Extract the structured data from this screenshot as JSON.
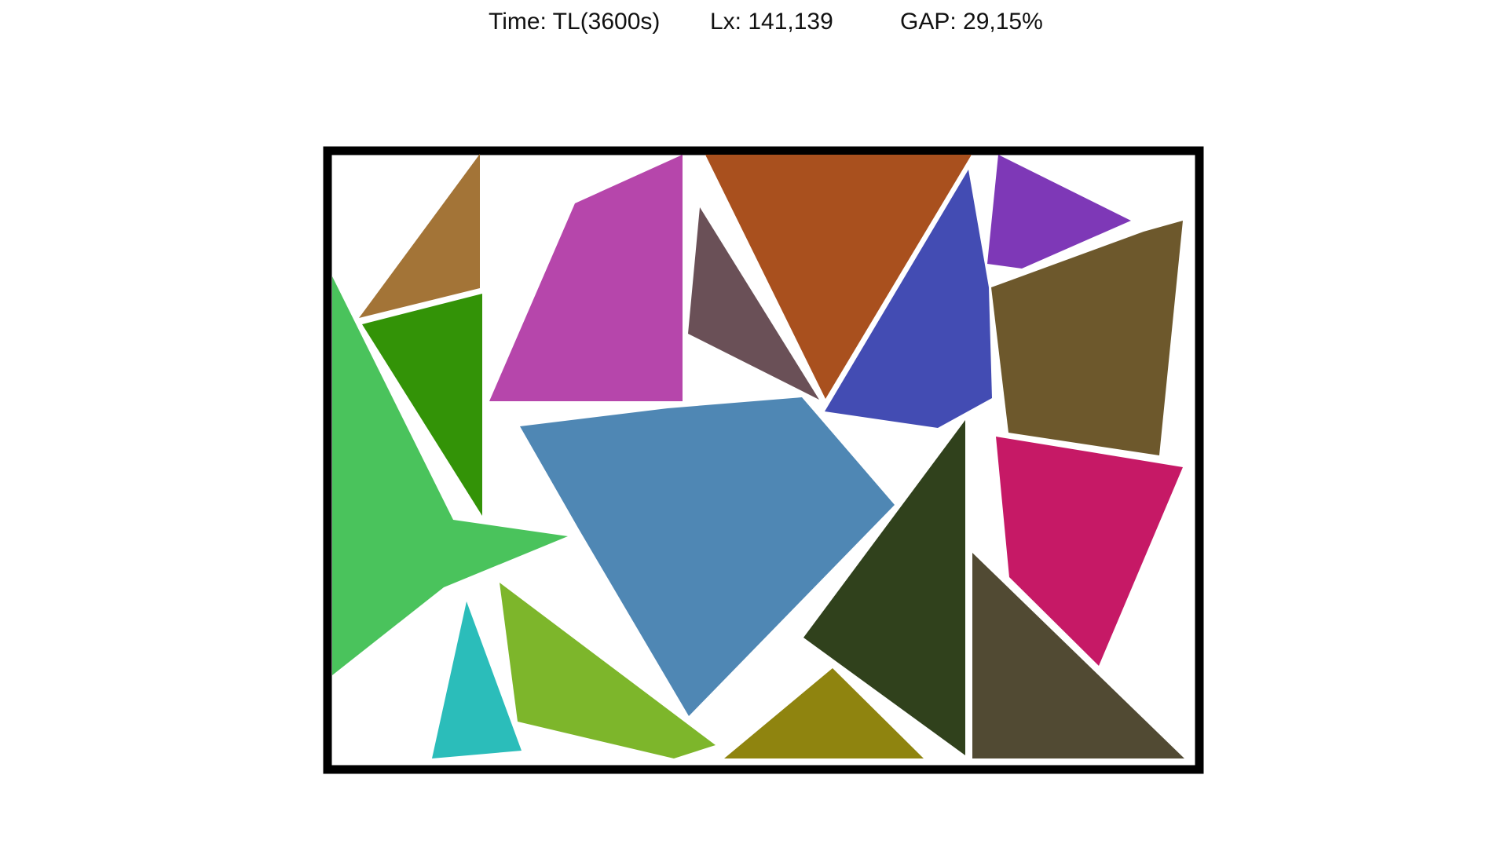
{
  "stats": {
    "time": "Time: TL(3600s)",
    "lx": "Lx: 141,139",
    "gap": "GAP: 29,15%"
  },
  "board": {
    "frame_color": "#000000",
    "pieces": [
      {
        "name": "piece-tan-triangle",
        "color": "#A37437"
      },
      {
        "name": "piece-dark-green-triangle",
        "color": "#339307"
      },
      {
        "name": "piece-light-green-star",
        "color": "#4AC35C"
      },
      {
        "name": "piece-magenta-quad",
        "color": "#B646AB"
      },
      {
        "name": "piece-orange-brown-triangle",
        "color": "#A9501E"
      },
      {
        "name": "piece-dusky-triangle",
        "color": "#6A5057"
      },
      {
        "name": "piece-indigo-polygon",
        "color": "#434CB3"
      },
      {
        "name": "piece-purple-triangle",
        "color": "#7E38B7"
      },
      {
        "name": "piece-olive-brown-quad",
        "color": "#6D582C"
      },
      {
        "name": "piece-steel-blue-polygon",
        "color": "#4F87B4"
      },
      {
        "name": "piece-crimson-quad",
        "color": "#C61966"
      },
      {
        "name": "piece-forest-triangle",
        "color": "#30411C"
      },
      {
        "name": "piece-charcoal-triangle",
        "color": "#514A33"
      },
      {
        "name": "piece-teal-triangle",
        "color": "#2BBDBA"
      },
      {
        "name": "piece-lime-triangle",
        "color": "#7DB62B"
      },
      {
        "name": "piece-mustard-triangle",
        "color": "#8F840F"
      }
    ]
  }
}
